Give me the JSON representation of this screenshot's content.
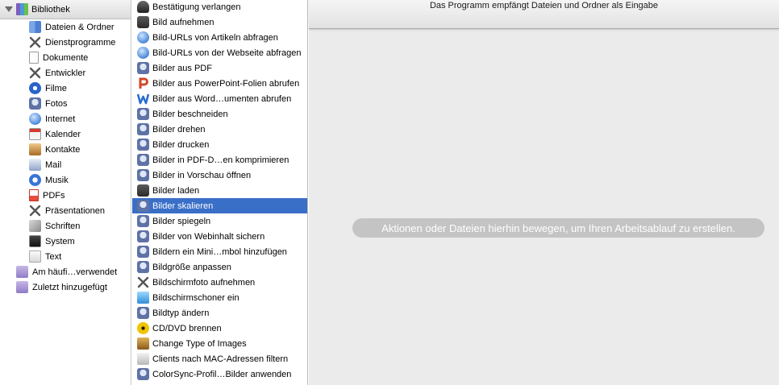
{
  "library": {
    "header": "Bibliothek",
    "items": [
      {
        "label": "Dateien & Ordner",
        "icon": "finder-icon"
      },
      {
        "label": "Dienstprogramme",
        "icon": "tools-icon"
      },
      {
        "label": "Dokumente",
        "icon": "document-icon"
      },
      {
        "label": "Entwickler",
        "icon": "tools-icon"
      },
      {
        "label": "Filme",
        "icon": "quicktime-icon"
      },
      {
        "label": "Fotos",
        "icon": "photo-robot-icon"
      },
      {
        "label": "Internet",
        "icon": "globe-icon"
      },
      {
        "label": "Kalender",
        "icon": "calendar-icon"
      },
      {
        "label": "Kontakte",
        "icon": "address-book-icon"
      },
      {
        "label": "Mail",
        "icon": "mail-icon"
      },
      {
        "label": "Musik",
        "icon": "itunes-icon"
      },
      {
        "label": "PDFs",
        "icon": "pdf-icon"
      },
      {
        "label": "Präsentationen",
        "icon": "tools-icon"
      },
      {
        "label": "Schriften",
        "icon": "font-icon"
      },
      {
        "label": "System",
        "icon": "system-icon"
      },
      {
        "label": "Text",
        "icon": "text-icon"
      }
    ],
    "smart_groups": [
      {
        "label": "Am häufi…verwendet",
        "icon": "smart-folder-icon"
      },
      {
        "label": "Zuletzt hinzugefügt",
        "icon": "smart-folder-icon"
      }
    ]
  },
  "actions": {
    "selected_index": 13,
    "selected_color": "#3a6fc8",
    "items": [
      {
        "label": "Bestätigung verlangen",
        "icon": "microphone-icon"
      },
      {
        "label": "Bild aufnehmen",
        "icon": "camera-icon"
      },
      {
        "label": "Bild-URLs von Artikeln abfragen",
        "icon": "globe-icon"
      },
      {
        "label": "Bild-URLs von der Webseite abfragen",
        "icon": "globe-icon"
      },
      {
        "label": "Bilder aus PDF",
        "icon": "photo-robot-icon"
      },
      {
        "label": "Bilder aus PowerPoint-Folien abrufen",
        "icon": "powerpoint-icon"
      },
      {
        "label": "Bilder aus Word…umenten abrufen",
        "icon": "word-icon"
      },
      {
        "label": "Bilder beschneiden",
        "icon": "photo-robot-icon"
      },
      {
        "label": "Bilder drehen",
        "icon": "photo-robot-icon"
      },
      {
        "label": "Bilder drucken",
        "icon": "photo-robot-icon"
      },
      {
        "label": "Bilder in PDF-D…en komprimieren",
        "icon": "photo-robot-icon"
      },
      {
        "label": "Bilder in Vorschau öffnen",
        "icon": "photo-robot-icon"
      },
      {
        "label": "Bilder laden",
        "icon": "camera-icon"
      },
      {
        "label": "Bilder skalieren",
        "icon": "photo-robot-icon"
      },
      {
        "label": "Bilder spiegeln",
        "icon": "photo-robot-icon"
      },
      {
        "label": "Bilder von Webinhalt sichern",
        "icon": "photo-robot-icon"
      },
      {
        "label": "Bildern ein Mini…mbol hinzufügen",
        "icon": "photo-robot-icon"
      },
      {
        "label": "Bildgröße anpassen",
        "icon": "photo-robot-icon"
      },
      {
        "label": "Bildschirmfoto aufnehmen",
        "icon": "tools-icon"
      },
      {
        "label": "Bildschirmschoner ein",
        "icon": "screensaver-icon"
      },
      {
        "label": "Bildtyp ändern",
        "icon": "photo-robot-icon"
      },
      {
        "label": "CD/DVD brennen",
        "icon": "burn-disc-icon"
      },
      {
        "label": "Change Type of Images",
        "icon": "script-icon"
      },
      {
        "label": "Clients nach MAC-Adressen filtern",
        "icon": "server-icon"
      },
      {
        "label": "ColorSync-Profil…Bilder anwenden",
        "icon": "photo-robot-icon"
      }
    ]
  },
  "workflow": {
    "input_text": "Das Programm empfängt Dateien und Ordner als Eingabe",
    "drop_hint": "Aktionen oder Dateien hierhin bewegen, um Ihren Arbeitsablauf zu erstellen."
  }
}
